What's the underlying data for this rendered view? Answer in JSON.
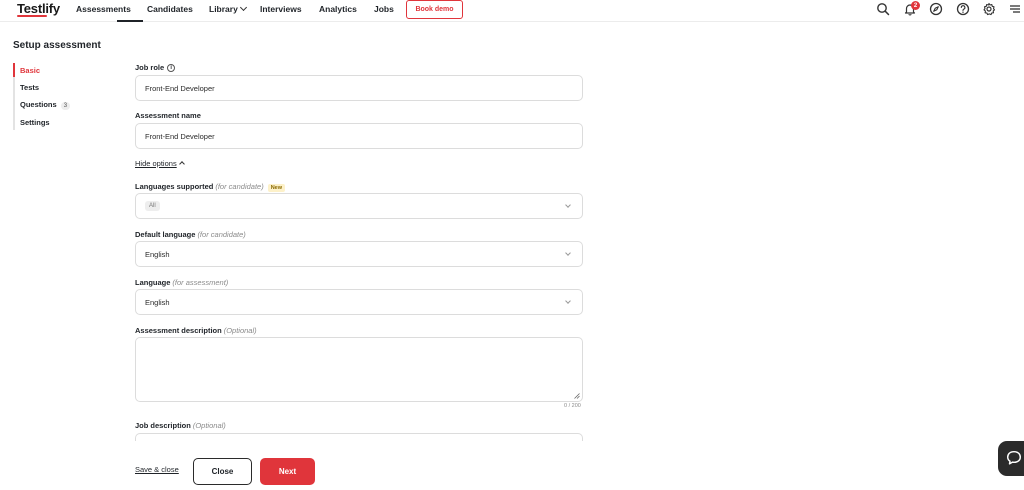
{
  "brand": {
    "logo": "Testlify",
    "accent": "#e0353b"
  },
  "nav": {
    "items": [
      "Assessments",
      "Candidates",
      "Library",
      "Interviews",
      "Analytics",
      "Jobs"
    ],
    "active": "Assessments",
    "cta": "Book demo",
    "notifications_count": "2",
    "icons": [
      "search-icon",
      "bell-icon",
      "compass-icon",
      "help-icon",
      "gear-icon",
      "menu-icon"
    ]
  },
  "page": {
    "title": "Setup assessment"
  },
  "steps": {
    "items": [
      {
        "label": "Basic"
      },
      {
        "label": "Tests"
      },
      {
        "label": "Questions",
        "count": "3"
      },
      {
        "label": "Settings"
      }
    ],
    "active": "Basic"
  },
  "form": {
    "job_role": {
      "label": "Job role",
      "value": "Front-End Developer"
    },
    "assessment_name": {
      "label": "Assessment name",
      "value": "Front-End Developer"
    },
    "hide_options": "Hide options",
    "languages_supported": {
      "label": "Languages supported",
      "hint": "(for candidate)",
      "badge": "New",
      "chip": "All"
    },
    "default_language": {
      "label": "Default language",
      "hint": "(for candidate)",
      "value": "English"
    },
    "language": {
      "label": "Language",
      "hint": "(for assessment)",
      "value": "English"
    },
    "assessment_description": {
      "label": "Assessment description",
      "hint": "(Optional)",
      "value": "",
      "counter": "0 / 200"
    },
    "job_description": {
      "label": "Job description",
      "hint": "(Optional)"
    }
  },
  "footer": {
    "save_close": "Save & close",
    "close": "Close",
    "next": "Next"
  }
}
